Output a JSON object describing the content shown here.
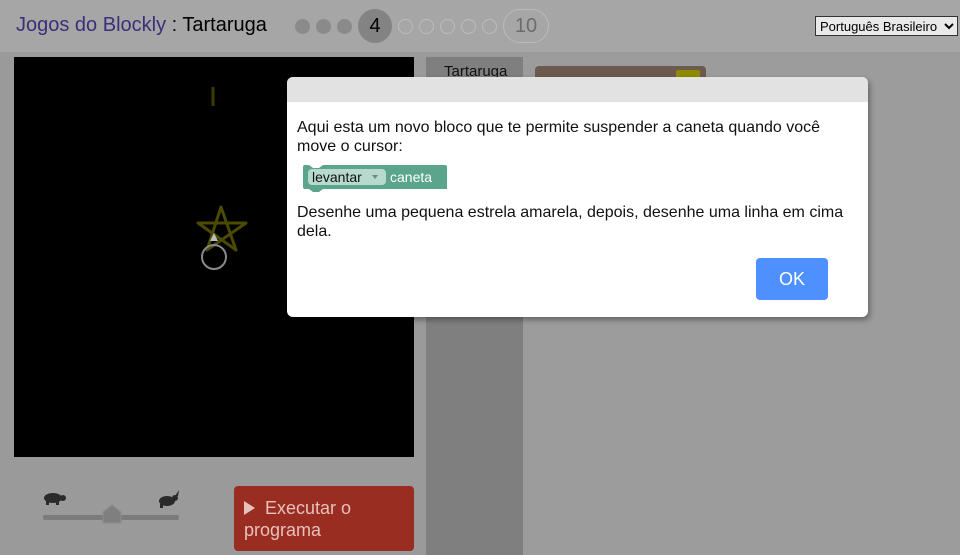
{
  "header": {
    "app_link": "Jogos do Blockly",
    "separator": " : ",
    "game_name": "Tartaruga",
    "current_level": "4",
    "last_level": "10",
    "language": "Português Brasileiro"
  },
  "toolbox": {
    "category": "Tartaruga"
  },
  "controls": {
    "run_label": "Executar o programa"
  },
  "dialog": {
    "intro": "Aqui esta um novo bloco que te permite suspender a caneta quando você move o cursor:",
    "block_dropdown": "levantar",
    "block_label": "caneta",
    "outro": "Desenhe uma pequena estrela amarela, depois, desenhe uma linha em cima dela.",
    "ok_label": "OK"
  },
  "icons": [
    "turtle-icon",
    "rabbit-icon",
    "dropdown-arrow-icon",
    "play-icon"
  ],
  "colors": {
    "run_button": "#c0392b",
    "ok_button": "#4d90fe",
    "pen_block": "#5ba58c",
    "star": "#ffff00"
  }
}
